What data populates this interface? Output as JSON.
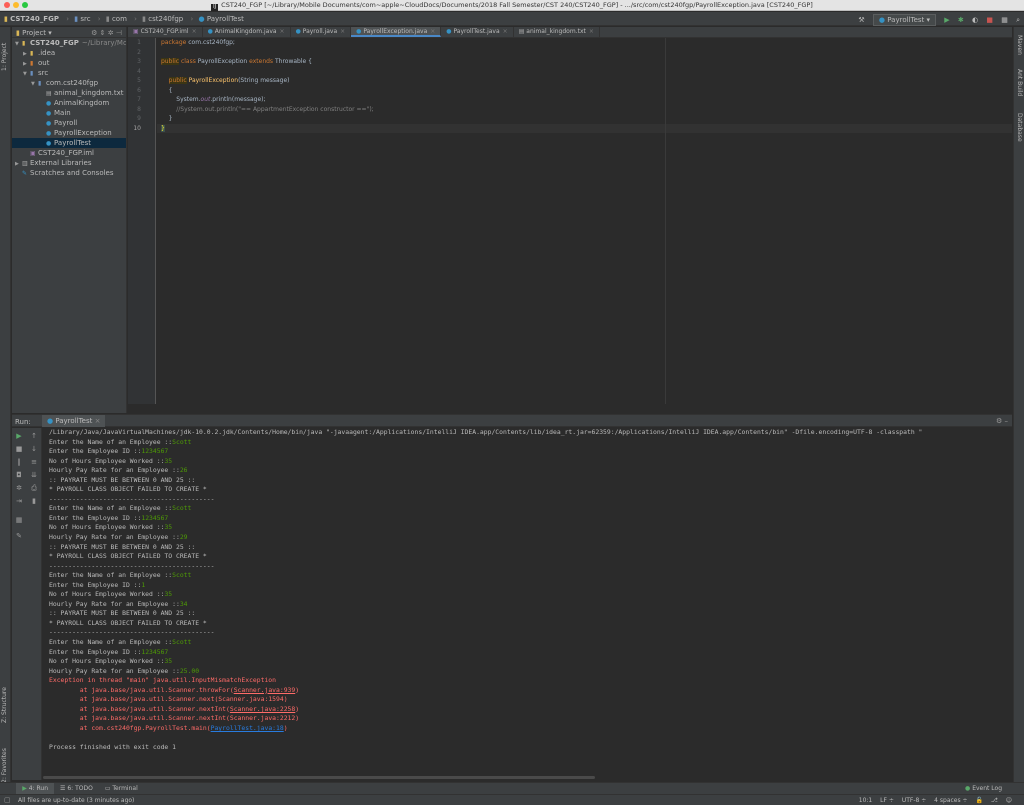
{
  "window": {
    "title": "CST240_FGP [~/Library/Mobile Documents/com~apple~CloudDocs/Documents/2018 Fall Semester/CST 240/CST240_FGP] - .../src/com/cst240fgp/PayrollException.java [CST240_FGP]",
    "app_icon": "IJ"
  },
  "breadcrumbs": [
    "CST240_FGP",
    "src",
    "com",
    "cst240fgp",
    "PayrollTest"
  ],
  "toolbar": {
    "run_config": "PayrollTest",
    "dropdown": "▾"
  },
  "left_stripe": {
    "project_tab": "1: Project",
    "structure_tab": "Z: Structure",
    "favorites_tab": "2: Favorites"
  },
  "right_stripe": {
    "maven_tab": "Maven",
    "ant_tab": "Ant Build",
    "database_tab": "Database"
  },
  "project_panel": {
    "header": "Project",
    "tree": [
      {
        "label": "CST240_FGP",
        "extra": "~/Library/Mob",
        "depth": 0,
        "icon": "folder",
        "expanded": true
      },
      {
        "label": ".idea",
        "depth": 1,
        "icon": "folder",
        "expanded": false
      },
      {
        "label": "out",
        "depth": 1,
        "icon": "folder-orange",
        "expanded": false
      },
      {
        "label": "src",
        "depth": 1,
        "icon": "folder-blue",
        "expanded": true
      },
      {
        "label": "com.cst240fgp",
        "depth": 2,
        "icon": "package",
        "expanded": true
      },
      {
        "label": "animal_kingdom.txt",
        "depth": 3,
        "icon": "txt"
      },
      {
        "label": "AnimalKingdom",
        "depth": 3,
        "icon": "class"
      },
      {
        "label": "Main",
        "depth": 3,
        "icon": "class"
      },
      {
        "label": "Payroll",
        "depth": 3,
        "icon": "class"
      },
      {
        "label": "PayrollException",
        "depth": 3,
        "icon": "class"
      },
      {
        "label": "PayrollTest",
        "depth": 3,
        "icon": "class",
        "selected": true
      },
      {
        "label": "CST240_FGP.iml",
        "depth": 1,
        "icon": "iml"
      },
      {
        "label": "External Libraries",
        "depth": 0,
        "icon": "lib",
        "expanded": false
      },
      {
        "label": "Scratches and Consoles",
        "depth": 0,
        "icon": "scratch"
      }
    ]
  },
  "editor_tabs": [
    {
      "label": "CST240_FGP.iml",
      "active": false
    },
    {
      "label": "AnimalKingdom.java",
      "active": false
    },
    {
      "label": "Payroll.java",
      "active": false
    },
    {
      "label": "PayrollException.java",
      "active": true
    },
    {
      "label": "PayrollTest.java",
      "active": false
    },
    {
      "label": "animal_kingdom.txt",
      "active": false
    }
  ],
  "editor": {
    "line_numbers": [
      "1",
      "2",
      "3",
      "4",
      "5",
      "6",
      "7",
      "8",
      "9",
      "10"
    ],
    "code": {
      "l1_kw": "package",
      "l1_rest": " com.cst240fgp;",
      "l3_kw1": "public",
      "l3_kw2": " class",
      "l3_name": " PayrollException ",
      "l3_kw3": "extends",
      "l3_rest": " Throwable ",
      "l3_brace": "{",
      "l5_kw": "public",
      "l5_name": " PayrollException",
      "l5_rest": "(String message)",
      "l6_brace": "{",
      "l7_a": "System.",
      "l7_fld": "out",
      "l7_b": ".println(message);",
      "l8_cmt": "//System.out.println(\"== AppartmentException constructor ==\");",
      "l9_brace": "}",
      "l10_brace": "}"
    }
  },
  "run_panel": {
    "label": "Run:",
    "tab": "PayrollTest",
    "console": {
      "cmd": "/Library/Java/JavaVirtualMachines/jdk-10.0.2.jdk/Contents/Home/bin/java \"-javaagent:/Applications/IntelliJ IDEA.app/Contents/lib/idea_rt.jar=62359:/Applications/IntelliJ IDEA.app/Contents/bin\" -Dfile.encoding=UTF-8 -classpath \"",
      "p_name": "Enter the Name of an Employee ::",
      "p_id": "Enter the Employee ID ::",
      "p_hours": "No of Hours Employee Worked ::",
      "p_rate": "Hourly Pay Rate for an Employee ::",
      "msg_range": ":: PAYRATE MUST BE BETWEEN 0 AND 25 ::",
      "msg_failed": "* PAYROLL CLASS OBJECT FAILED TO CREATE *",
      "separator": "-------------------------------------------",
      "b1": {
        "name": "Scott",
        "id": "1234567",
        "hours": "35",
        "rate": "26"
      },
      "b2": {
        "name": "Scott",
        "id": "1234567",
        "hours": "35",
        "rate": "29"
      },
      "b3": {
        "name": "Scott",
        "id": "1",
        "hours": "35",
        "rate": "34"
      },
      "b4": {
        "name": "Scott",
        "id": "1234567",
        "hours": "35",
        "rate": "25.00"
      },
      "exc": "Exception in thread \"main\" java.util.InputMismatchException",
      "st1_pre": "\tat java.base/java.util.Scanner.throwFor(",
      "st1_link": "Scanner.java:939",
      "st2_pre": "\tat java.base/java.util.Scanner.next(",
      "st2_link": "Scanner.java:1594",
      "st3_pre": "\tat java.base/java.util.Scanner.nextInt(",
      "st3_link": "Scanner.java:2258",
      "st4_pre": "\tat java.base/java.util.Scanner.nextInt(",
      "st4_link": "Scanner.java:2212",
      "st5_pre": "\tat com.cst240fgp.PayrollTest.main(",
      "st5_link": "PayrollTest.java:18",
      "close_paren": ")",
      "exit": "Process finished with exit code 1"
    }
  },
  "bottom_tabs": [
    {
      "label": "4: Run",
      "active": true
    },
    {
      "label": "6: TODO",
      "active": false
    },
    {
      "label": "Terminal",
      "active": false
    }
  ],
  "event_log": "Event Log",
  "status": {
    "message": "All files are up-to-date (3 minutes ago)",
    "position": "10:1",
    "line_sep": "LF ÷",
    "encoding": "UTF-8 ÷",
    "indent": "4 spaces ÷"
  },
  "colors": {
    "accent": "#4a88c7",
    "console_error": "#ff6b68",
    "console_input": "#4e9a06",
    "keyword": "#cc7832"
  }
}
